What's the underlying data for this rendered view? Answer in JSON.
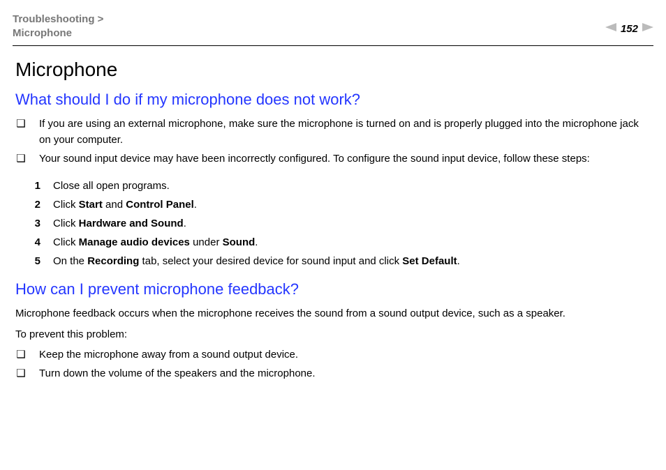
{
  "header": {
    "breadcrumb_parent": "Troubleshooting",
    "breadcrumb_sep": ">",
    "breadcrumb_child": "Microphone",
    "page_number": "152"
  },
  "main": {
    "title": "Microphone",
    "section1": {
      "heading": "What should I do if my microphone does not work?",
      "bullets": [
        "If you are using an external microphone, make sure the microphone is turned on and is properly plugged into the microphone jack on your computer.",
        "Your sound input device may have been incorrectly configured. To configure the sound input device, follow these steps:"
      ],
      "steps": [
        {
          "n": "1",
          "pre": "Close all open programs."
        },
        {
          "n": "2",
          "pre": "Click ",
          "b1": "Start",
          "mid": " and ",
          "b2": "Control Panel",
          "post": "."
        },
        {
          "n": "3",
          "pre": "Click ",
          "b1": "Hardware and Sound",
          "post": "."
        },
        {
          "n": "4",
          "pre": "Click ",
          "b1": "Manage audio devices",
          "mid": " under ",
          "b2": "Sound",
          "post": "."
        },
        {
          "n": "5",
          "pre": "On the ",
          "b1": "Recording",
          "mid": " tab, select your desired device for sound input and click ",
          "b2": "Set Default",
          "post": "."
        }
      ]
    },
    "section2": {
      "heading": "How can I prevent microphone feedback?",
      "para1": "Microphone feedback occurs when the microphone receives the sound from a sound output device, such as a speaker.",
      "para2": "To prevent this problem:",
      "bullets": [
        "Keep the microphone away from a sound output device.",
        "Turn down the volume of the speakers and the microphone."
      ]
    }
  }
}
